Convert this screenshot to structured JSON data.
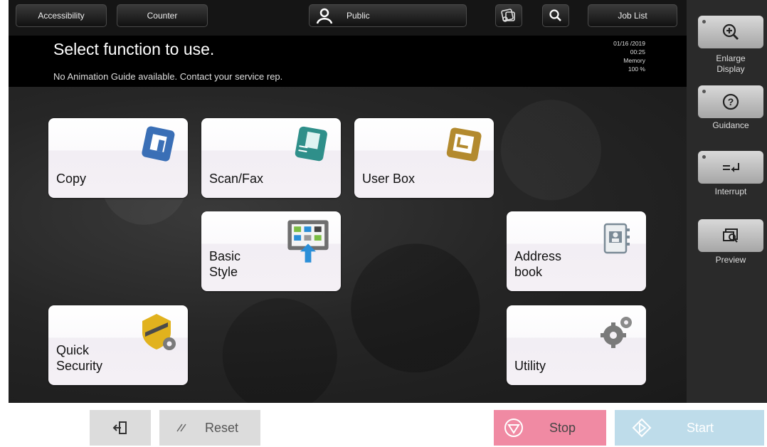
{
  "header": {
    "accessibility_label": "Accessibility",
    "counter_label": "Counter",
    "user_label": "Public",
    "job_list_label": "Job List"
  },
  "message": {
    "title": "Select function to use.",
    "subtitle": "No Animation Guide available. Contact your service rep.",
    "date": "01/16 /2019",
    "time": "00:25",
    "memory_label": "Memory",
    "memory_value": "100 %"
  },
  "tiles": [
    {
      "label": "Copy",
      "icon": "copy-icon",
      "color": "#3a6fb6"
    },
    {
      "label": "Scan/Fax",
      "icon": "scan-fax-icon",
      "color": "#2f8f8a"
    },
    {
      "label": "User Box",
      "icon": "user-box-icon",
      "color": "#b38a2e"
    },
    {
      "label": "Basic\nStyle",
      "icon": "basic-style-icon",
      "color": "#2a8fd8"
    },
    {
      "label": "Address\nbook",
      "icon": "address-book-icon",
      "color": "#7a8a96"
    },
    {
      "label": "Quick\nSecurity",
      "icon": "quick-security-icon",
      "color": "#e1b21e"
    },
    {
      "label": "Utility",
      "icon": "utility-icon",
      "color": "#7a7a7a"
    }
  ],
  "side": {
    "enlarge_label": "Enlarge\nDisplay",
    "guidance_label": "Guidance",
    "interrupt_label": "Interrupt",
    "preview_label": "Preview"
  },
  "bottom": {
    "reset_label": "Reset",
    "stop_label": "Stop",
    "start_label": "Start"
  },
  "colors": {
    "stop": "#f08aa3",
    "start": "#bedcea"
  }
}
